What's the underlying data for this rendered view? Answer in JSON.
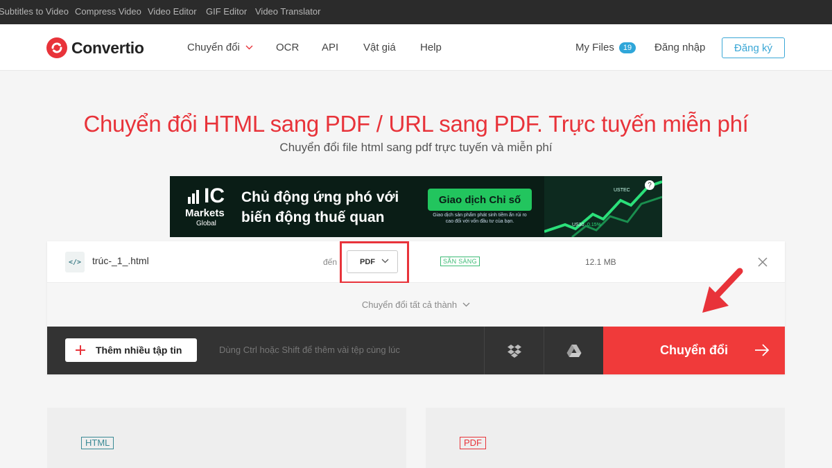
{
  "topbar": {
    "links": [
      "Subtitles to Video",
      "Compress Video",
      "Video Editor",
      "GIF Editor",
      "Video Translator"
    ]
  },
  "header": {
    "logo_text": "Convertio",
    "nav": {
      "convert": "Chuyển đổi",
      "ocr": "OCR",
      "api": "API",
      "pricing": "Vật giá",
      "help": "Help"
    },
    "my_files": "My Files",
    "my_files_count": "19",
    "login": "Đăng nhập",
    "signup": "Đăng ký"
  },
  "page": {
    "title": "Chuyển đổi HTML sang PDF / URL sang PDF. Trực tuyến miễn phí",
    "subtitle": "Chuyển đổi file html sang pdf trực tuyến và miễn phí"
  },
  "ad": {
    "brand_ic": "IC",
    "brand_markets": "Markets",
    "brand_global": "Global",
    "headline_line1": "Chủ động ứng phó với",
    "headline_line2": "biến động thuế quan",
    "button": "Giao dịch Chỉ số",
    "small_line1": "Giao dịch sản phẩm phát sinh tiềm ẩn rủi ro",
    "small_line2": "cao đối với vốn đầu tư của bạn.",
    "ticker1": "USTEC",
    "ticker2": "US30",
    "ticker2_value": "0.15%"
  },
  "file": {
    "icon_glyph": "</>",
    "name": "trúc-_1_.html",
    "to_label": "đến",
    "format": "PDF",
    "status": "SẴN SÀNG",
    "size": "12.1 MB",
    "convert_all": "Chuyển đổi tất cả thành"
  },
  "actions": {
    "add_files": "Thêm nhiều tập tin",
    "hint": "Dùng Ctrl hoặc Shift để thêm vài tệp cùng lúc",
    "convert": "Chuyển đổi"
  },
  "bottom": {
    "left_tag": "HTML",
    "right_tag": "PDF"
  },
  "colors": {
    "brand_red": "#e8333a",
    "accent_blue": "#2fa6d9",
    "ready_green": "#3dbb75",
    "dark_bar": "#333333"
  }
}
